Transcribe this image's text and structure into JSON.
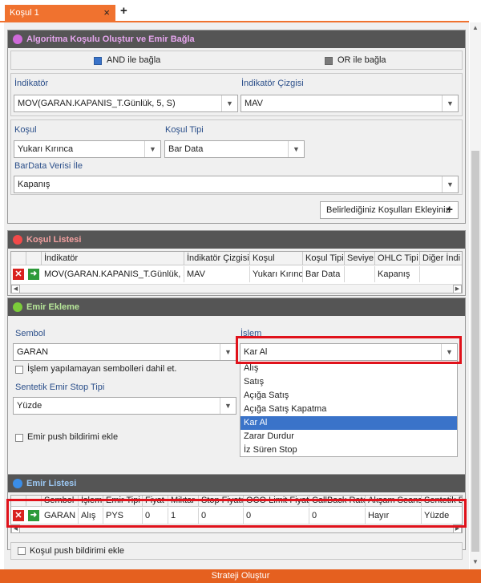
{
  "tab": {
    "title": "Koşul 1",
    "close": "×",
    "add": "+"
  },
  "algo": {
    "title": "Algoritma Koşulu Oluştur ve Emir Bağla",
    "and_label": "AND ile bağla",
    "or_label": "OR ile bağla",
    "indicator_label": "İndikatör",
    "indicator_value": "MOV(GARAN.KAPANIS_T.Günlük, 5, S)",
    "line_label": "İndikatör Çizgisi",
    "line_value": "MAV",
    "condition_label": "Koşul",
    "condition_value": "Yukarı Kırınca",
    "condition_type_label": "Koşul Tipi",
    "condition_type_value": "Bar Data",
    "bardata_label": "BarData Verisi İle",
    "bardata_value": "Kapanış",
    "add_button": "Belirlediğiniz Koşulları Ekleyiniz"
  },
  "condlist": {
    "title": "Koşul Listesi",
    "headers": [
      "İndikatör",
      "İndikatör Çizgisi",
      "Koşul",
      "Koşul Tipi",
      "Seviye",
      "OHLC Tipi",
      "Diğer İndi"
    ],
    "row": [
      "MOV(GARAN.KAPANIS_T.Günlük, 5, S)",
      "MAV",
      "Yukarı Kırınca",
      "Bar Data",
      "",
      "Kapanış",
      ""
    ]
  },
  "order": {
    "title": "Emir Ekleme",
    "symbol_label": "Sembol",
    "symbol_value": "GARAN",
    "action_label": "İşlem",
    "action_value": "Kar Al",
    "include_label": "İşlem yapılamayan sembolleri dahil et.",
    "stop_type_label": "Sentetik Emir Stop Tipi",
    "stop_type_value": "Yüzde",
    "push_label": "Emir push bildirimi ekle",
    "options": [
      "Alış",
      "Satış",
      "Açığa Satış",
      "Açığa Satış Kapatma",
      "Kar Al",
      "Zarar Durdur",
      "İz Süren Stop"
    ],
    "selected_index": 4
  },
  "orderlist": {
    "title": "Emir Listesi",
    "headers": [
      "Sembol",
      "İşlem",
      "Emir Tipi",
      "Fiyat",
      "Miktar",
      "Stop Fiyatı",
      "OCO Limit Fiyatı",
      "CallBack Rate",
      "Akşam Seansı",
      "Sentetik E"
    ],
    "row": [
      "GARAN",
      "Alış",
      "PYS",
      "0",
      "1",
      "0",
      "0",
      "0",
      "Hayır",
      "Yüzde"
    ]
  },
  "cond_push_label": "Koşul push bildirimi ekle",
  "footer_button": "Strateji Oluştur",
  "colors": {
    "accent": "#f0722f",
    "header": "#555555",
    "algo_dot": "#cf6ad9",
    "list_dot": "#f24a4a",
    "order_dot": "#7bcc3a",
    "orderlist_dot": "#3a8de8",
    "highlight": "#e0121b"
  }
}
